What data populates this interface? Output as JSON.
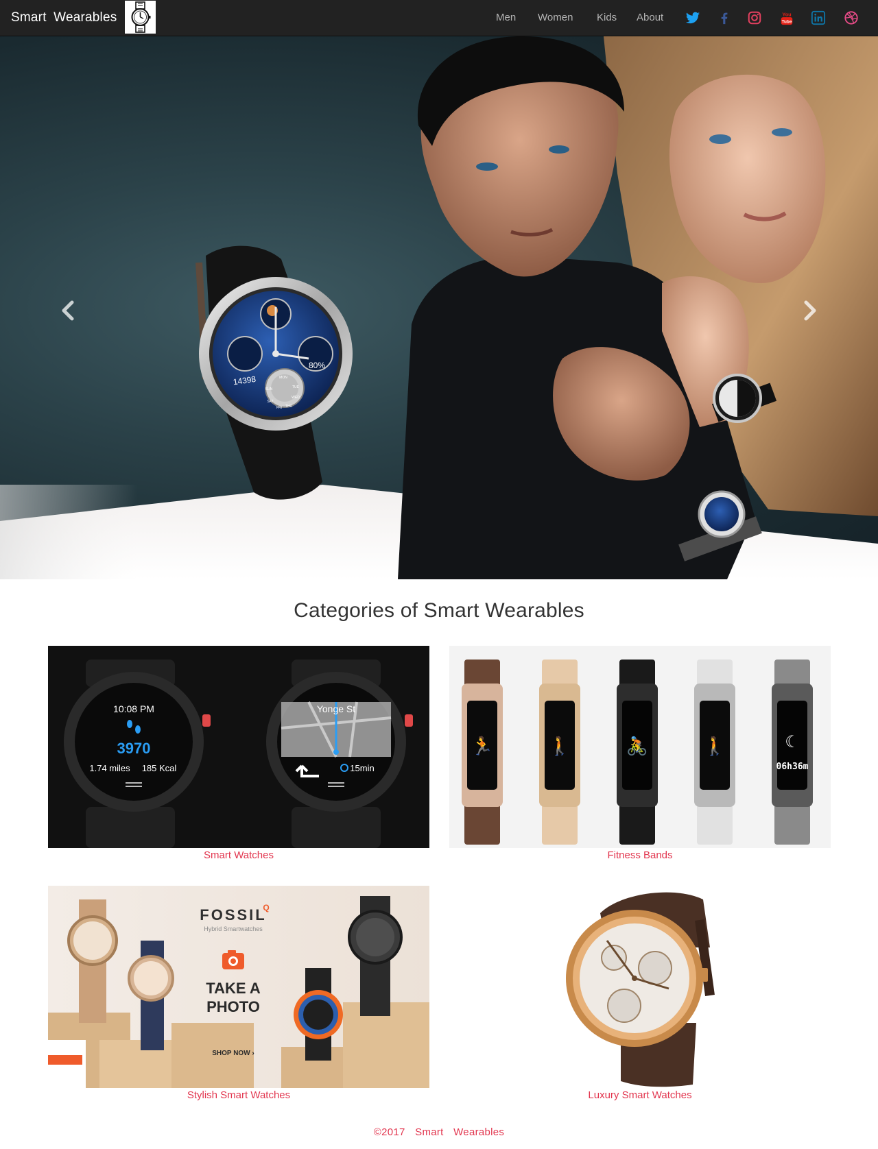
{
  "navbar": {
    "brand": "Smart  Wearables",
    "logo_icon": "watch-logo-icon",
    "links": [
      "Men",
      "Women",
      "Kids",
      "About"
    ],
    "social": [
      {
        "icon": "twitter-icon",
        "color": "#1da1f2"
      },
      {
        "icon": "facebook-icon",
        "color": "#3b5998"
      },
      {
        "icon": "instagram-icon",
        "color": "#e4405f"
      },
      {
        "icon": "youtube-icon",
        "color": "#e62117"
      },
      {
        "icon": "linkedin-icon",
        "color": "#0e76a8"
      },
      {
        "icon": "dribbble-icon",
        "color": "#ea4c89"
      }
    ]
  },
  "carousel": {
    "prev_icon": "chevron-left-icon",
    "next_icon": "chevron-right-icon",
    "watch_face": {
      "steps": "14398",
      "battery": "80%",
      "days": [
        "MON",
        "TUE",
        "WED",
        "THU",
        "FRI",
        "SAT",
        "SUN"
      ]
    }
  },
  "categories": {
    "title": "Categories of Smart Wearables",
    "items": [
      {
        "label": "Smart Watches",
        "left_watch": {
          "time": "10:08 PM",
          "steps": "3970",
          "distance": "1.74 miles",
          "calories": "185 Kcal"
        },
        "right_watch": {
          "street": "Yonge St",
          "eta": "15min"
        }
      },
      {
        "label": "Fitness Bands",
        "band_time": "06h36m"
      },
      {
        "label": "Stylish Smart Watches",
        "brand": "FOSSIL",
        "brand_mark": "Q",
        "subtitle": "Hybrid Smartwatches",
        "headline_1": "TAKE A",
        "headline_2": "PHOTO",
        "cta": "SHOP NOW ›"
      },
      {
        "label": "Luxury Smart Watches"
      }
    ]
  },
  "footer": {
    "text": "©2017  Smart  Wearables"
  }
}
